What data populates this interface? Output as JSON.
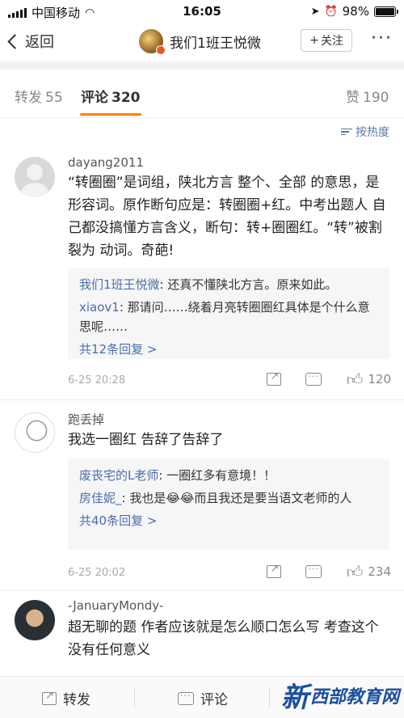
{
  "status_bar": {
    "carrier": "中国移动",
    "time": "16:05",
    "battery_text": "98%",
    "battery_level": 0.98
  },
  "nav": {
    "back_label": "返回",
    "title": "我们1班王悦微",
    "follow_label": "关注",
    "follow_plus": "+",
    "more_label": "···"
  },
  "tabs": [
    {
      "label": "转发",
      "count": "55"
    },
    {
      "label": "评论",
      "count": "320"
    },
    {
      "label": "赞",
      "count": "190"
    }
  ],
  "sort_label": "按热度",
  "comments": [
    {
      "user": "dayang2011",
      "text": "“转圈圈”是词组，陕北方言 整个、全部 的意思，是形容词。原作断句应是：转圈圈+红。中考出题人 自己都没搞懂方言含义，断句：转+圈圈红。“转”被割裂为 动词。奇葩!",
      "replies": [
        {
          "name": "我们1班王悦微",
          "text": ": 还真不懂陕北方言。原来如此。"
        },
        {
          "name": "xiaov1",
          "text": ": 那请问……绕着月亮转圈圈红具体是个什么意思呢……"
        }
      ],
      "more_replies": "共12条回复 >",
      "time": "6-25 20:28",
      "likes": "120"
    },
    {
      "user": "跑丢掉",
      "text": "我选一圈红 告辞了告辞了",
      "replies": [
        {
          "name": "废丧宅的L老师",
          "text": ": 一圈红多有意境！！"
        },
        {
          "name": "房佳妮_",
          "text": ": 我也是😂😂而且我还是要当语文老师的人"
        }
      ],
      "more_replies": "共40条回复 >",
      "time": "6-25 20:02",
      "likes": "234"
    },
    {
      "user": "-JanuaryMondy-",
      "text": "超无聊的题 作者应该就是怎么顺口怎么写 考查这个没有任何意义"
    }
  ],
  "bottom_bar": {
    "repost": "转发",
    "comment": "评论"
  },
  "watermark": {
    "big": "新",
    "small": "西部教育网"
  }
}
